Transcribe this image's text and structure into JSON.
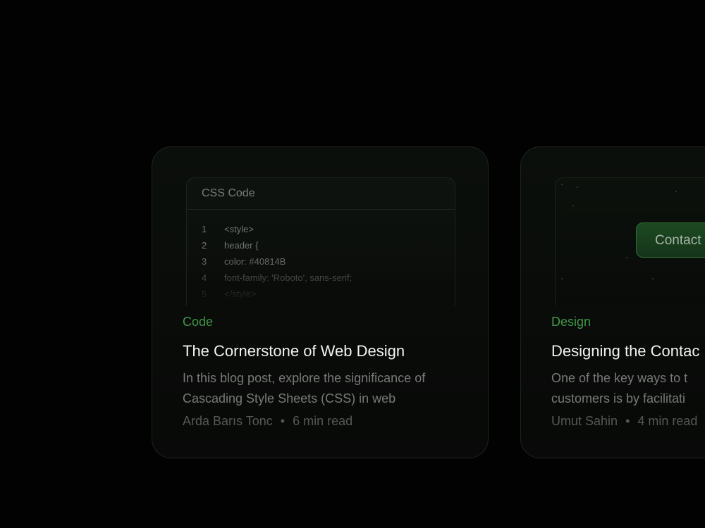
{
  "cards": [
    {
      "preview_type": "code",
      "code_window_title": "CSS Code",
      "code_lines": [
        {
          "num": "1",
          "text": "<style>"
        },
        {
          "num": "2",
          "text": "header {"
        },
        {
          "num": "3",
          "text": "color: #40814B"
        },
        {
          "num": "4",
          "text": "font-family: 'Roboto', sans-serif;"
        },
        {
          "num": "5",
          "text": "</style>"
        }
      ],
      "category": "Code",
      "title": "The Cornerstone of Web Design",
      "excerpt": "In this blog post, explore the significance of Cascading Style Sheets (CSS) in web",
      "author": "Arda Barıs Tonc",
      "separator": "•",
      "read_time": "6 min read"
    },
    {
      "preview_type": "button",
      "button_label": "Contact",
      "category": "Design",
      "title": "Designing the Contac",
      "excerpt": "One of the key ways to t customers is by facilitati",
      "author": "Umut Sahin",
      "separator": "•",
      "read_time": "4 min read"
    }
  ],
  "colors": {
    "background": "#000000",
    "category": "#3f9a44",
    "title": "#f2f2f2",
    "muted": "#777a77",
    "button_green": "#1d4a22"
  }
}
